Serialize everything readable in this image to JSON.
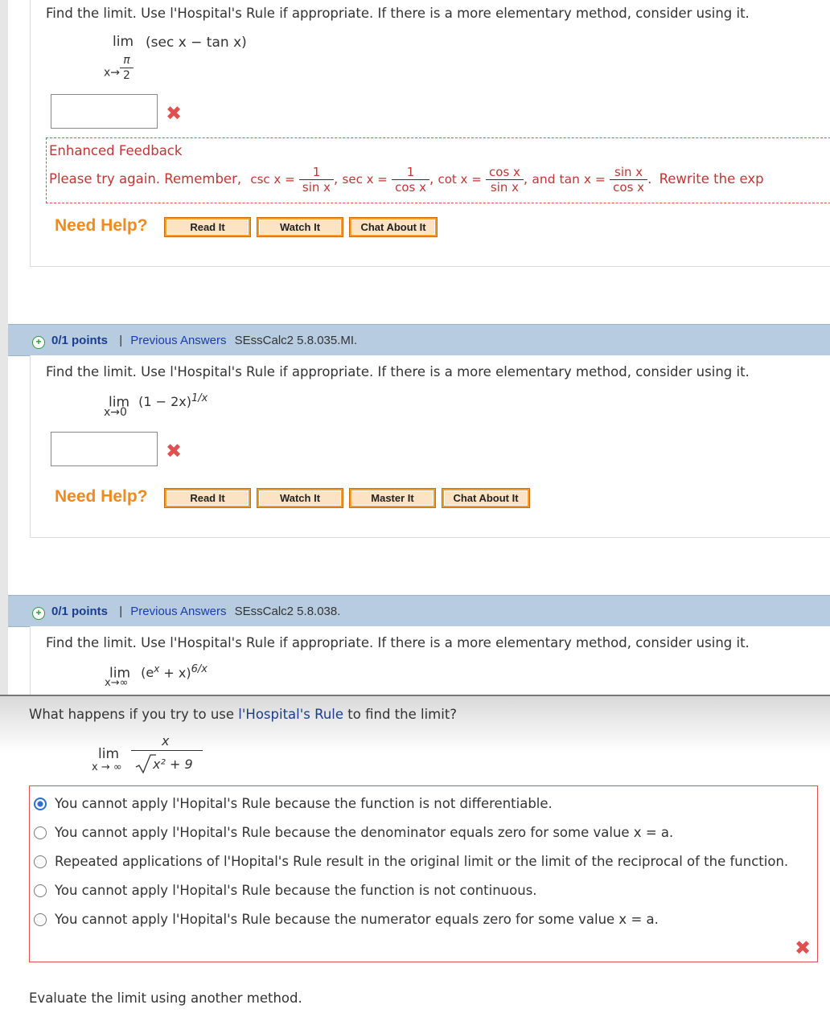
{
  "q1": {
    "prompt": "Find the limit. Use l'Hospital's Rule if appropriate. If there is a more elementary method, consider using it.",
    "lim": "lim",
    "expr": "(sec x − tan x)",
    "sub_var": "x→",
    "sub_num": "π",
    "sub_den": "2",
    "answer_value": "",
    "mark": "✖",
    "feedback": {
      "title": "Enhanced Feedback",
      "lead": "Please try again. Remember,",
      "csc": "csc x =",
      "sec": "sec x =",
      "cot": "cot x =",
      "and_tan": "and  tan x =",
      "one": "1",
      "sin_x": "sin x",
      "cos_x": "cos x",
      "tail": "Rewrite the exp"
    },
    "need_help": "Need Help?",
    "buttons": [
      "Read It",
      "Watch It",
      "Chat About It"
    ]
  },
  "q2": {
    "points": "0/1 points",
    "sep": "|",
    "prev": "Previous Answers",
    "code": "SEssCalc2 5.8.035.MI.",
    "prompt": "Find the limit. Use l'Hospital's Rule if appropriate. If there is a more elementary method, consider using it.",
    "lim": "lim",
    "sub": "x→0",
    "expr": "(1 − 2x)",
    "exp": "1/x",
    "answer_value": "",
    "mark": "✖",
    "need_help": "Need Help?",
    "buttons": [
      "Read It",
      "Watch It",
      "Master It",
      "Chat About It"
    ]
  },
  "q3": {
    "points": "0/1 points",
    "sep": "|",
    "prev": "Previous Answers",
    "code": "SEssCalc2 5.8.038.",
    "prompt": "Find the limit. Use l'Hospital's Rule if appropriate. If there is a more elementary method, consider using it.",
    "lim": "lim",
    "sub": "x→∞",
    "expr": "(e",
    "expr_sup": "x",
    "expr_tail": " + x)",
    "exp": "6/x"
  },
  "overlay": {
    "q_pre": "What happens if you try to use ",
    "q_link": "l'Hospital's Rule",
    "q_post": " to find the limit?",
    "lim": "lim",
    "sub": "x → ∞",
    "num": "x",
    "den": "x² + 9",
    "choices": [
      "You cannot apply l'Hopital's Rule because the function is not differentiable.",
      "You cannot apply l'Hopital's Rule because the denominator equals zero for some value x = a.",
      "Repeated applications of l'Hopital's Rule result in the original limit or the limit of the reciprocal of the function.",
      "You cannot apply l'Hopital's Rule because the function is not continuous.",
      "You cannot apply l'Hopital's Rule because the numerator equals zero for some value x = a."
    ],
    "selected_index": 0,
    "mark": "✖",
    "next": "Evaluate the limit using another method."
  }
}
